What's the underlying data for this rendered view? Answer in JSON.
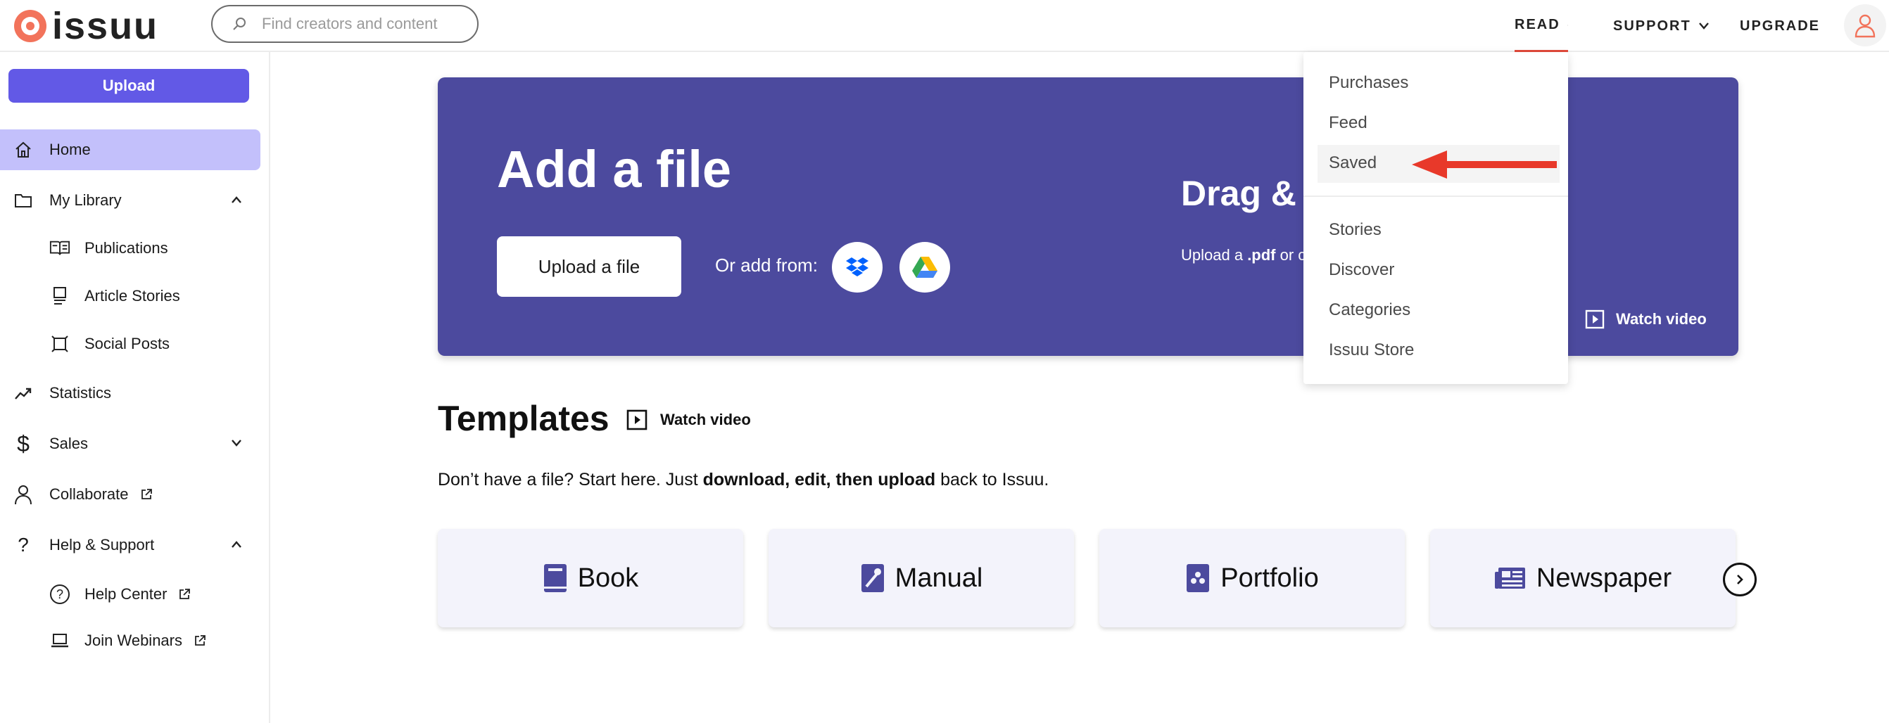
{
  "header": {
    "logo_text": "issuu",
    "search_placeholder": "Find creators and content",
    "nav": {
      "read": "READ",
      "support": "SUPPORT",
      "upgrade": "UPGRADE"
    }
  },
  "sidebar": {
    "upload_label": "Upload",
    "items": {
      "home": "Home",
      "my_library": "My Library",
      "publications": "Publications",
      "article_stories": "Article Stories",
      "social_posts": "Social Posts",
      "statistics": "Statistics",
      "sales": "Sales",
      "collaborate": "Collaborate",
      "help_support": "Help & Support",
      "help_center": "Help Center",
      "join_webinars": "Join Webinars"
    }
  },
  "hero": {
    "title": "Add a file",
    "upload_button": "Upload a file",
    "or_add_from": "Or add from:",
    "drag_title": "Drag & ",
    "drag_desc_prefix": "Upload a ",
    "drag_desc_bold": ".pdf",
    "drag_desc_suffix": " or c",
    "watch_video": "Watch video"
  },
  "templates": {
    "title": "Templates",
    "watch_video": "Watch video",
    "desc_prefix": "Don’t have a file? Start here. Just ",
    "desc_bold": "download, edit, then upload",
    "desc_suffix": " back to Issuu.",
    "cards": {
      "book": "Book",
      "manual": "Manual",
      "portfolio": "Portfolio",
      "newspaper": "Newspaper"
    }
  },
  "dropdown": {
    "items": {
      "purchases": "Purchases",
      "feed": "Feed",
      "saved": "Saved",
      "stories": "Stories",
      "discover": "Discover",
      "categories": "Categories",
      "issuu_store": "Issuu Store"
    }
  },
  "colors": {
    "accent": "#6259e6",
    "hero_bg": "#4c4a9e",
    "active_item": "#c3c0fb",
    "arrow": "#e8392a",
    "logo": "#f2735b"
  }
}
